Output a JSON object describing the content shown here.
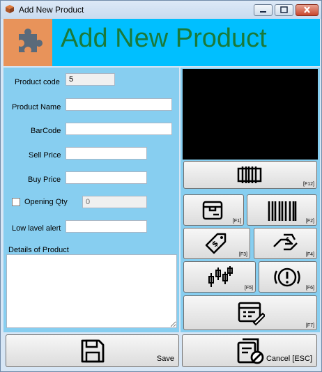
{
  "window": {
    "title": "Add New Product",
    "icons": {
      "app": "cube-icon",
      "minimize": "minimize-icon",
      "maximize": "maximize-icon",
      "close": "close-icon"
    }
  },
  "banner": {
    "title": "Add New Product",
    "icon": "puzzle-icon",
    "background": "#00bfff",
    "icon_background": "#e8935a",
    "title_color": "#1a7a3a"
  },
  "form": {
    "product_code_label": "Product code",
    "product_code_value": "5",
    "product_name_label": "Product Name",
    "product_name_value": "",
    "barcode_label": "BarCode",
    "barcode_value": "",
    "sell_price_label": "Sell Price",
    "sell_price_value": "",
    "buy_price_label": "Buy Price",
    "buy_price_value": "",
    "opening_qty_label": "Opening Qty",
    "opening_qty_checked": false,
    "opening_qty_value": "0",
    "low_level_alert_label": "Low lavel alert",
    "low_level_alert_value": "",
    "details_label": "Details of Product",
    "details_value": ""
  },
  "actions": {
    "barcode_scan": {
      "key": "[F12]",
      "icon": "barcode-scanner-icon"
    },
    "f1": {
      "key": "[F1]",
      "icon": "box-icon"
    },
    "f2": {
      "key": "[F2]",
      "icon": "barcode-icon"
    },
    "f3": {
      "key": "[F3]",
      "icon": "price-tag-icon"
    },
    "f4": {
      "key": "[F4]",
      "icon": "hand-money-icon"
    },
    "f5": {
      "key": "[F5]",
      "icon": "candlestick-icon"
    },
    "f6": {
      "key": "[F6]",
      "icon": "alert-icon"
    },
    "f7": {
      "key": "[F7]",
      "icon": "form-edit-icon"
    },
    "save": {
      "label": "Save",
      "icon": "save-icon"
    },
    "cancel": {
      "label": "Cancel [ESC]",
      "icon": "cancel-document-icon"
    }
  },
  "colors": {
    "panel": "#87cef0",
    "window": "#d7e6f5",
    "preview": "#000000"
  }
}
